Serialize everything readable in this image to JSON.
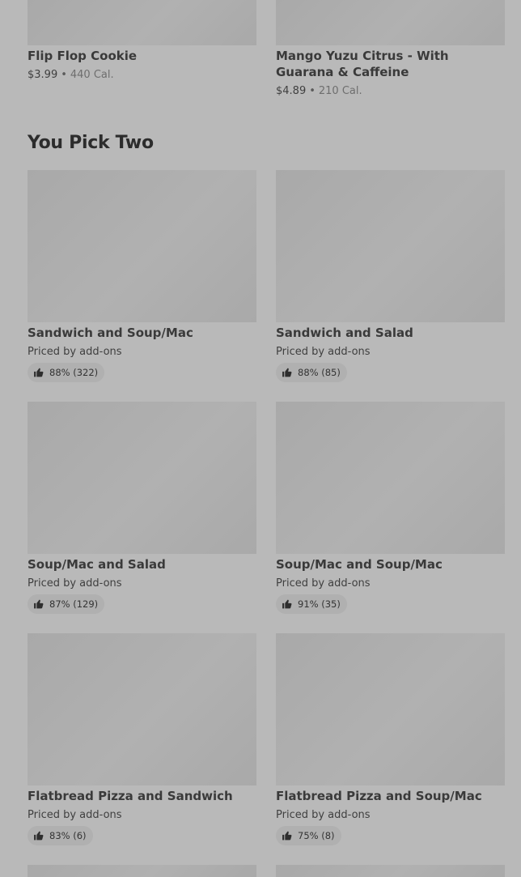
{
  "top_items": [
    {
      "name": "Flip Flop Cookie",
      "price": "$3.99",
      "separator": "•",
      "calories": "440 Cal."
    },
    {
      "name": "Mango Yuzu Citrus - With Guarana & Caffeine",
      "price": "$4.89",
      "separator": "•",
      "calories": "210 Cal."
    }
  ],
  "section": {
    "title": "You Pick Two"
  },
  "items": [
    {
      "name": "Sandwich and Soup/Mac",
      "price_note": "Priced by add-ons",
      "rating": "88% (322)"
    },
    {
      "name": "Sandwich and Salad",
      "price_note": "Priced by add-ons",
      "rating": "88% (85)"
    },
    {
      "name": "Soup/Mac and Salad",
      "price_note": "Priced by add-ons",
      "rating": "87% (129)"
    },
    {
      "name": "Soup/Mac and Soup/Mac",
      "price_note": "Priced by add-ons",
      "rating": "91% (35)"
    },
    {
      "name": "Flatbread Pizza and Sandwich",
      "price_note": "Priced by add-ons",
      "rating": "83% (6)"
    },
    {
      "name": "Flatbread Pizza and Soup/Mac",
      "price_note": "Priced by add-ons",
      "rating": "75% (8)"
    }
  ],
  "icons": {
    "rating": "thumbs-up-icon"
  }
}
